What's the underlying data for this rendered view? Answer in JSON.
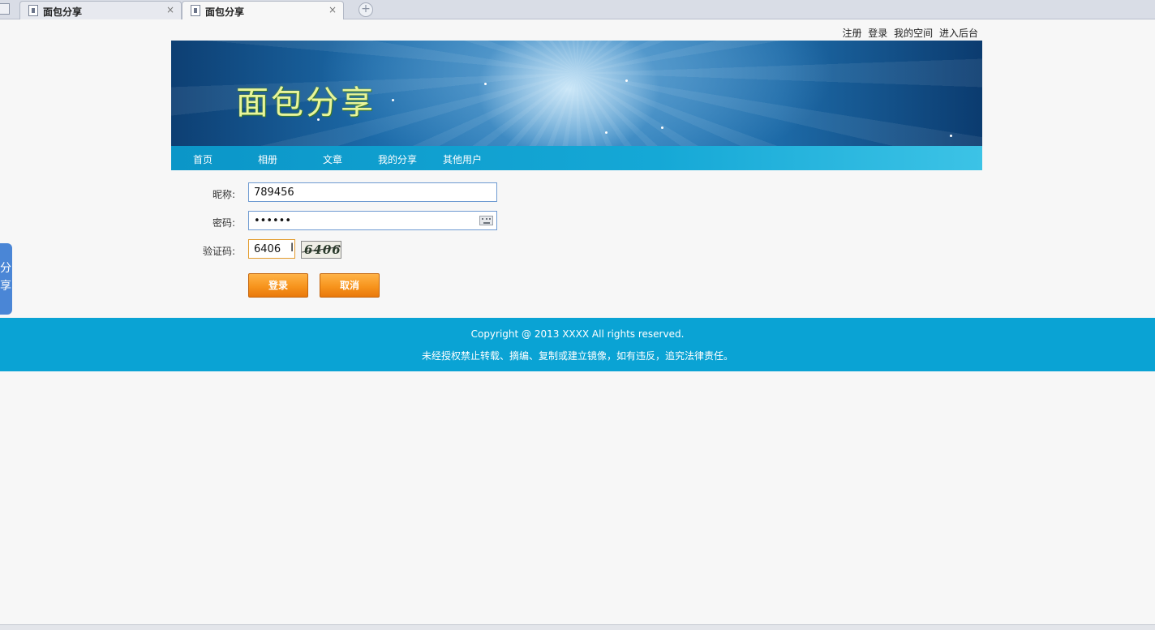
{
  "browser": {
    "tabs": [
      {
        "title": "面包分享",
        "close": "×"
      },
      {
        "title": "面包分享",
        "close": "×"
      }
    ],
    "new_tab": "+"
  },
  "toplinks": {
    "register": "注册",
    "login": "登录",
    "my_space": "我的空间",
    "admin": "进入后台"
  },
  "banner": {
    "logo_text": "面包分享"
  },
  "nav": {
    "items": [
      "首页",
      "相册",
      "文章",
      "我的分享",
      "其他用户"
    ]
  },
  "form": {
    "nickname_label": "昵称:",
    "nickname_value": "789456",
    "password_label": "密码:",
    "password_value": "••••••",
    "captcha_label": "验证码:",
    "captcha_value": "6406",
    "captcha_image_text": "6406",
    "login_button": "登录",
    "cancel_button": "取消"
  },
  "side_tab": {
    "text_line1": "分",
    "text_line2": "享"
  },
  "footer": {
    "copyright": "Copyright @ 2013 XXXX All rights reserved.",
    "notice": "未经授权禁止转载、摘编、复制或建立镜像，如有违反，追究法律责任。"
  },
  "colors": {
    "nav_bg": "#0b96c8",
    "footer_bg": "#0aa3d4",
    "button_orange": "#f7941d",
    "input_border": "#6e9ad1"
  }
}
